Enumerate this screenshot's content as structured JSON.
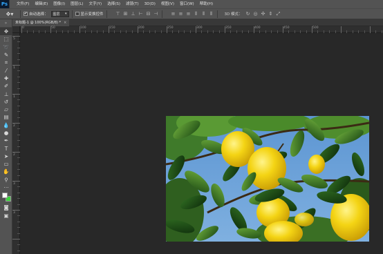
{
  "app": {
    "logo": "Ps"
  },
  "menu": [
    {
      "label": "文件(F)"
    },
    {
      "label": "编辑(E)"
    },
    {
      "label": "图像(I)"
    },
    {
      "label": "图层(L)"
    },
    {
      "label": "文字(Y)"
    },
    {
      "label": "选择(S)"
    },
    {
      "label": "滤镜(T)"
    },
    {
      "label": "3D(D)"
    },
    {
      "label": "视图(V)"
    },
    {
      "label": "窗口(W)"
    },
    {
      "label": "帮助(H)"
    }
  ],
  "options": {
    "tool_icon": "move-tool-icon",
    "auto_select_checked": "✔",
    "auto_select_label": "自动选择：",
    "auto_select_target": "图层",
    "show_transform_label": "显示变换控件",
    "mode_3d_label": "3D 模式："
  },
  "document": {
    "tab_title": "未标题-1 @ 100%(RGB/8) *",
    "close_glyph": "×"
  },
  "ruler_h_labels": [
    "0",
    "50",
    "100",
    "150",
    "200",
    "250",
    "300",
    "350",
    "400",
    "450",
    "500"
  ],
  "ruler_v_labels": [
    "5",
    "1",
    "1",
    "2",
    "2",
    "3",
    "3"
  ],
  "colors": {
    "foreground": "#ffffff",
    "background": "#3cd43c"
  }
}
